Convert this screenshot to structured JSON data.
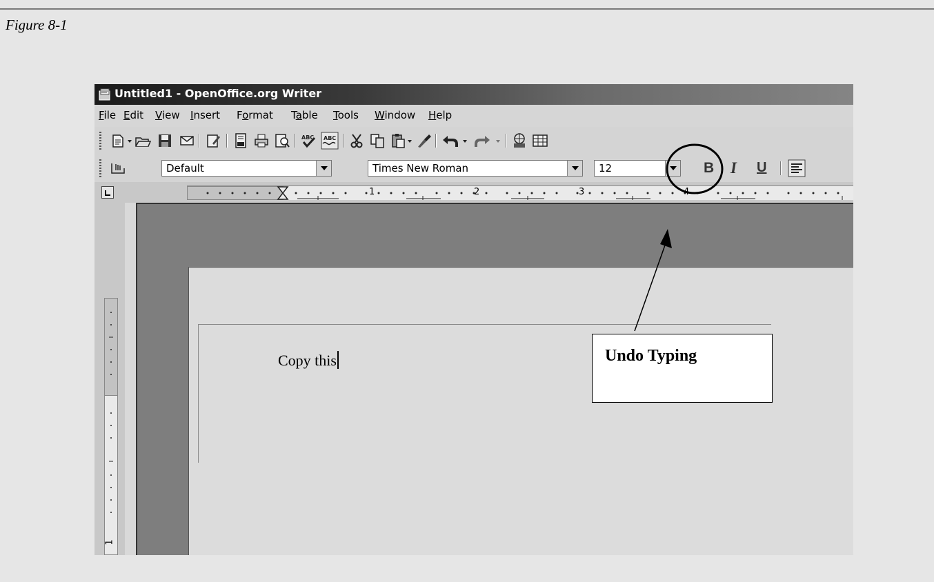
{
  "caption": "Figure 8-1",
  "window": {
    "title": "Untitled1 - OpenOffice.org Writer"
  },
  "menu": [
    {
      "pre": "",
      "u": "F",
      "post": "ile"
    },
    {
      "pre": "",
      "u": "E",
      "post": "dit"
    },
    {
      "pre": "",
      "u": "V",
      "post": "iew"
    },
    {
      "pre": "",
      "u": "I",
      "post": "nsert"
    },
    {
      "pre": "F",
      "u": "o",
      "post": "rmat"
    },
    {
      "pre": "T",
      "u": "a",
      "post": "ble"
    },
    {
      "pre": "",
      "u": "T",
      "post": "ools"
    },
    {
      "pre": "",
      "u": "W",
      "post": "indow"
    },
    {
      "pre": "",
      "u": "H",
      "post": "elp"
    }
  ],
  "format_toolbar": {
    "style": "Default",
    "font": "Times New Roman",
    "size": "12",
    "bold": "B",
    "italic": "I",
    "underline": "U"
  },
  "ruler": {
    "numbers": [
      "1",
      "2",
      "3",
      "4"
    ],
    "vertical_number": "1"
  },
  "document": {
    "text": "Copy this"
  },
  "callout": {
    "label": "Undo Typing"
  },
  "icons": [
    "new-icon",
    "open-icon",
    "save-icon",
    "email-icon",
    "edit-file-icon",
    "export-pdf-icon",
    "print-icon",
    "page-preview-icon",
    "spellcheck-icon",
    "autospellcheck-icon",
    "cut-icon",
    "copy-icon",
    "paste-icon",
    "format-paintbrush-icon",
    "undo-icon",
    "redo-icon",
    "navigator-icon",
    "table-icon",
    "stylist-icon",
    "align-left-icon"
  ]
}
